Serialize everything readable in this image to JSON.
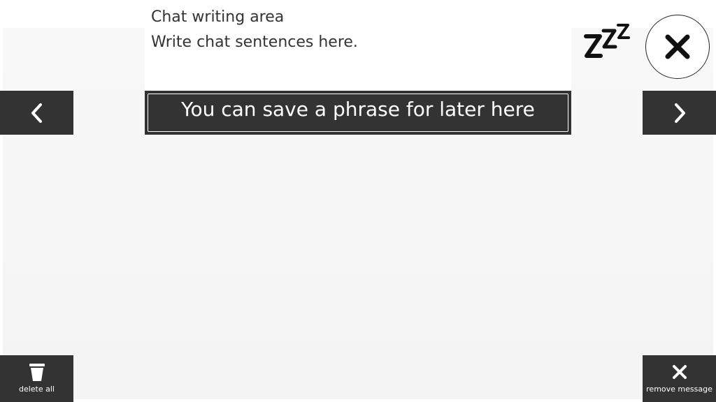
{
  "writing_area": {
    "title": "Chat writing area",
    "placeholder": "Write chat sentences here."
  },
  "phrase_bar": {
    "text": "You can save a phrase for later here"
  },
  "nav": {
    "prev_icon": "chevron-left-icon",
    "next_icon": "chevron-right-icon"
  },
  "top_controls": {
    "sleep_icon": "sleep-zzz-icon",
    "close_icon": "close-icon"
  },
  "bottom_controls": {
    "delete_all_label": "delete all",
    "delete_all_icon": "trash-icon",
    "remove_message_label": "remove message",
    "remove_message_icon": "close-icon"
  },
  "colors": {
    "bar_dark": "#333333",
    "text_dark": "#333333",
    "background": "#f6f6f6",
    "white": "#ffffff"
  }
}
